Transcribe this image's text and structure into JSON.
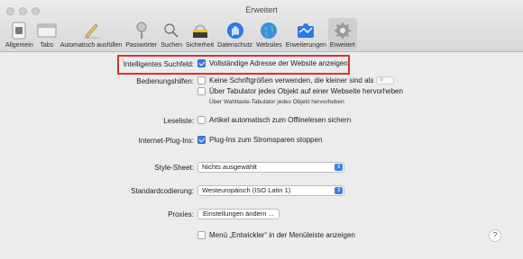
{
  "window": {
    "title": "Erweitert"
  },
  "toolbar": {
    "items": [
      {
        "label": "Allgemein",
        "icon": "switch-icon"
      },
      {
        "label": "Tabs",
        "icon": "tabs-icon"
      },
      {
        "label": "Automatisch ausfüllen",
        "icon": "pencil-icon"
      },
      {
        "label": "Passwörter",
        "icon": "key-icon"
      },
      {
        "label": "Suchen",
        "icon": "magnifier-icon"
      },
      {
        "label": "Sicherheit",
        "icon": "security-icon"
      },
      {
        "label": "Datenschutz",
        "icon": "hand-icon"
      },
      {
        "label": "Websites",
        "icon": "globe-icon"
      },
      {
        "label": "Erweiterungen",
        "icon": "puzzle-icon"
      },
      {
        "label": "Erweitert",
        "icon": "gear-icon"
      }
    ],
    "active_index": 9
  },
  "settings": {
    "smart_search": {
      "label": "Intelligentes Suchfeld:",
      "option": "Vollständige Adresse der Website anzeigen",
      "checked": true
    },
    "accessibility": {
      "label": "Bedienungshilfen:",
      "font_size_option": "Keine Schriftgrößen verwenden, die kleiner sind als",
      "font_size_value": "9",
      "tab_option": "Über Tabulator jedes Objekt auf einer Webseite hervorheben",
      "tab_hint": "Über Wahltaste-Tabulator jedes Objekt hervorheben"
    },
    "reading_list": {
      "label": "Leseliste:",
      "option": "Artikel automatisch zum Offlinelesen sichern"
    },
    "plugins": {
      "label": "Internet-Plug-Ins:",
      "option": "Plug-Ins zum Stromsparen stoppen",
      "checked": true
    },
    "stylesheet": {
      "label": "Style-Sheet:",
      "value": "Nichts ausgewählt"
    },
    "encoding": {
      "label": "Standardcodierung:",
      "value": "Westeuropäisch (ISO Latin 1)"
    },
    "proxies": {
      "label": "Proxies:",
      "button": "Einstellungen ändern ..."
    },
    "developer": {
      "option": "Menü „Entwickler“ in der Menüleiste anzeigen"
    },
    "help": "?"
  },
  "colors": {
    "accent": "#3a7ee6",
    "highlight": "#e0302e"
  }
}
